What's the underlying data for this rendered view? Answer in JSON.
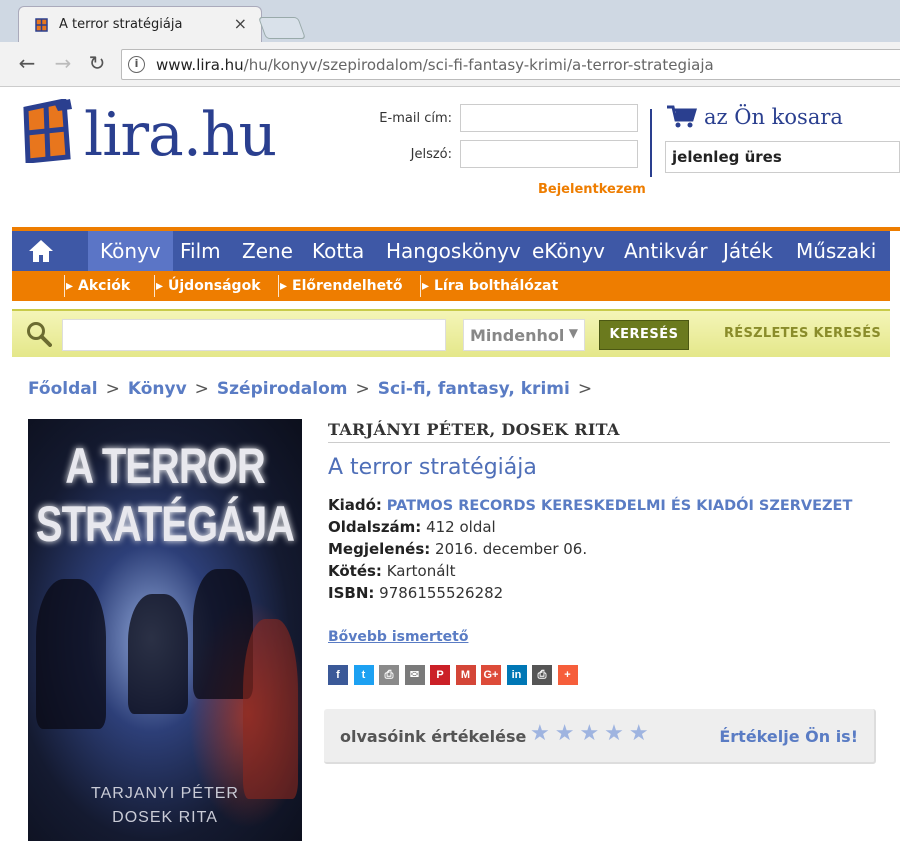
{
  "browser": {
    "tab_title": "A terror stratégiája",
    "tab_close": "×",
    "back": "←",
    "forward": "→",
    "reload": "↻",
    "url_host": "www.lira.hu",
    "url_path": "/hu/konyv/szepirodalom/sci-fi-fantasy-krimi/a-terror-strategiaja"
  },
  "header": {
    "logo_text": "lira.hu",
    "email_label": "E-mail cím:",
    "password_label": "Jelszó:",
    "login_button": "Bejelentkezem",
    "cart_title": "az Ön kosara",
    "cart_status": "jelenleg üres"
  },
  "nav": {
    "items": [
      "Könyv",
      "Film",
      "Zene",
      "Kotta",
      "Hangoskönyv",
      "eKönyv",
      "Antikvár",
      "Játék",
      "Műszaki"
    ],
    "subitems": [
      "Akciók",
      "Újdonságok",
      "Előrendelhető",
      "Líra bolthálózat"
    ]
  },
  "search": {
    "scope": "Mindenhol",
    "scope_arrow": "▼",
    "button": "KERESÉS",
    "advanced": "RÉSZLETES KERESÉS"
  },
  "breadcrumb": [
    "Főoldal",
    "Könyv",
    "Szépirodalom",
    "Sci-fi, fantasy, krimi"
  ],
  "breadcrumb_sep": ">",
  "book": {
    "cover_title_1": "A TERROR",
    "cover_title_2": "STRATÉGÁJA",
    "cover_author_1": "TARJANYI PÉTER",
    "cover_author_2": "DOSEK RITA",
    "authors": "TARJÁNYI PÉTER, DOSEK RITA",
    "title": "A terror stratégiája",
    "publisher_label": "Kiadó:",
    "publisher": "PATMOS RECORDS KERESKEDELMI ÉS KIADÓI SZERVEZET",
    "pages_label": "Oldalszám:",
    "pages": "412 oldal",
    "release_label": "Megjelenés:",
    "release": "2016. december 06.",
    "binding_label": "Kötés:",
    "binding": "Kartonált",
    "isbn_label": "ISBN:",
    "isbn": "9786155526282",
    "more_link": "Bővebb ismertető"
  },
  "share": {
    "buttons": [
      {
        "glyph": "f",
        "color": "#3b5998",
        "icon": "facebook-icon"
      },
      {
        "glyph": "t",
        "color": "#1da1f2",
        "icon": "twitter-icon"
      },
      {
        "glyph": "⎙",
        "color": "#8a8a8a",
        "icon": "print-icon"
      },
      {
        "glyph": "✉",
        "color": "#7a7a7a",
        "icon": "email-icon"
      },
      {
        "glyph": "P",
        "color": "#cb2027",
        "icon": "pinterest-icon"
      },
      {
        "glyph": "M",
        "color": "#d44638",
        "icon": "gmail-icon"
      },
      {
        "glyph": "G+",
        "color": "#dd4b39",
        "icon": "googleplus-icon"
      },
      {
        "glyph": "in",
        "color": "#0077b5",
        "icon": "linkedin-icon"
      },
      {
        "glyph": "⎙",
        "color": "#555555",
        "icon": "printer-friendly-icon"
      },
      {
        "glyph": "+",
        "color": "#f65e3b",
        "icon": "more-share-icon"
      }
    ]
  },
  "rating": {
    "label": "olvasóink értékelése",
    "stars": "★★★★★",
    "rate_link": "Értékelje Ön is!"
  },
  "colors": {
    "brand_blue": "#2a3f8f",
    "nav_blue": "#3e58a6",
    "accent_orange": "#ee7d00",
    "link_blue": "#5a7cc4",
    "search_green": "#6b7a1e"
  }
}
